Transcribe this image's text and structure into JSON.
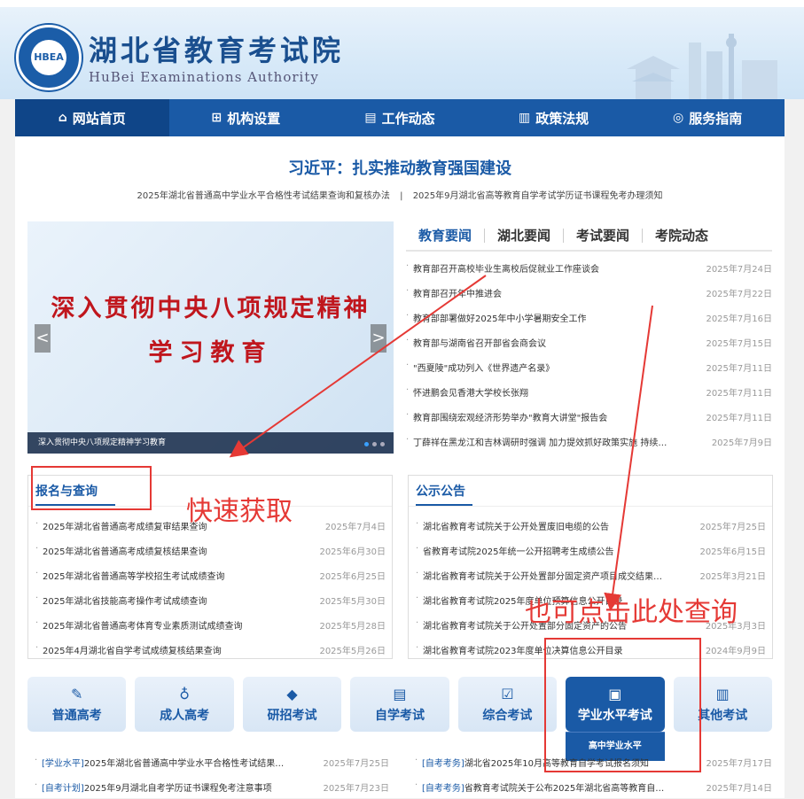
{
  "header": {
    "site_name_cn": "湖北省教育考试院",
    "site_name_en": "HuBei Examinations Authority",
    "logo_text": "HBEA"
  },
  "nav": {
    "items": [
      {
        "label": "网站首页",
        "icon": "home-icon"
      },
      {
        "label": "机构设置",
        "icon": "org-chart-icon"
      },
      {
        "label": "工作动态",
        "icon": "document-icon"
      },
      {
        "label": "政策法规",
        "icon": "book-icon"
      },
      {
        "label": "服务指南",
        "icon": "compass-icon"
      }
    ]
  },
  "headline": {
    "title": "习近平：扎实推动教育强国建设",
    "link1": "2025年湖北省普通高中学业水平合格性考试结果查询和复核办法",
    "separator": "|",
    "link2": "2025年9月湖北省高等教育自学考试学历证书课程免考办理须知"
  },
  "slider": {
    "line1": "深入贯彻中央八项规定精神",
    "line2": "学习教育",
    "caption": "深入贯彻中央八项规定精神学习教育",
    "prev": "<",
    "next": ">"
  },
  "news": {
    "tabs": [
      "教育要闻",
      "湖北要闻",
      "考试要闻",
      "考院动态"
    ],
    "items": [
      {
        "title": "教育部召开高校毕业生离校后促就业工作座谈会",
        "date": "2025年7月24日"
      },
      {
        "title": "教育部召开年中推进会",
        "date": "2025年7月22日"
      },
      {
        "title": "教育部部署做好2025年中小学暑期安全工作",
        "date": "2025年7月16日"
      },
      {
        "title": "教育部与湖南省召开部省会商会议",
        "date": "2025年7月15日"
      },
      {
        "title": "\"西夏陵\"成功列入《世界遗产名录》",
        "date": "2025年7月11日"
      },
      {
        "title": "怀进鹏会见香港大学校长张翔",
        "date": "2025年7月11日"
      },
      {
        "title": "教育部围绕宏观经济形势举办\"教育大讲堂\"报告会",
        "date": "2025年7月11日"
      },
      {
        "title": "丁薛祥在黑龙江和吉林调研时强调 加力提效抓好政策实施 持续…",
        "date": "2025年7月9日"
      }
    ]
  },
  "registration": {
    "title": "报名与查询",
    "items": [
      {
        "title": "2025年湖北省普通高考成绩复审结果查询",
        "date": "2025年7月4日"
      },
      {
        "title": "2025年湖北省普通高考成绩复核结果查询",
        "date": "2025年6月30日"
      },
      {
        "title": "2025年湖北省普通高等学校招生考试成绩查询",
        "date": "2025年6月25日"
      },
      {
        "title": "2025年湖北省技能高考操作考试成绩查询",
        "date": "2025年5月30日"
      },
      {
        "title": "2025年湖北省普通高考体育专业素质测试成绩查询",
        "date": "2025年5月28日"
      },
      {
        "title": "2025年4月湖北省自学考试成绩复核结果查询",
        "date": "2025年5月26日"
      }
    ]
  },
  "announcements": {
    "title": "公示公告",
    "items": [
      {
        "title": "湖北省教育考试院关于公开处置废旧电缆的公告",
        "date": "2025年7月25日"
      },
      {
        "title": "省教育考试院2025年统一公开招聘考生成绩公告",
        "date": "2025年6月15日"
      },
      {
        "title": "湖北省教育考试院关于公开处置部分固定资产项目成交结果…",
        "date": "2025年3月21日"
      },
      {
        "title": "湖北省教育考试院2025年度单位预算信息公开目录",
        "date": ""
      },
      {
        "title": "湖北省教育考试院关于公开处置部分固定资产的公告",
        "date": "2025年3月3日"
      },
      {
        "title": "湖北省教育考试院2023年度单位决算信息公开目录",
        "date": "2024年9月9日"
      }
    ]
  },
  "exam_categories": {
    "items": [
      {
        "label": "普通高考",
        "icon": "person-pen-icon"
      },
      {
        "label": "成人高考",
        "icon": "medal-icon"
      },
      {
        "label": "研招考试",
        "icon": "graduation-cap-icon"
      },
      {
        "label": "自学考试",
        "icon": "notebook-icon"
      },
      {
        "label": "综合考试",
        "icon": "clipboard-icon"
      },
      {
        "label": "学业水平考试",
        "icon": "certificate-icon"
      },
      {
        "label": "其他考试",
        "icon": "book-open-icon"
      }
    ],
    "dropdown": "高中学业水平"
  },
  "bottom_news": {
    "left": [
      {
        "tag": "[学业水平]",
        "title": "2025年湖北省普通高中学业水平合格性考试结果…",
        "date": "2025年7月25日"
      },
      {
        "tag": "[自考计划]",
        "title": "2025年9月湖北自考学历证书课程免考注意事项",
        "date": "2025年7月23日"
      }
    ],
    "right": [
      {
        "tag": "[自考考务]",
        "title": "湖北省2025年10月高等教育自学考试报名须知",
        "date": "2025年7月17日"
      },
      {
        "tag": "[自考考务]",
        "title": "省教育考试院关于公布2025年湖北省高等教育自…",
        "date": "2025年7月14日"
      }
    ]
  },
  "annotations": {
    "quick_get": "快速获取",
    "click_here": "也可点击此处查询",
    "color": "#e53935"
  },
  "colors": {
    "brand": "#1a5aa6",
    "slide_text": "#c0161d"
  }
}
